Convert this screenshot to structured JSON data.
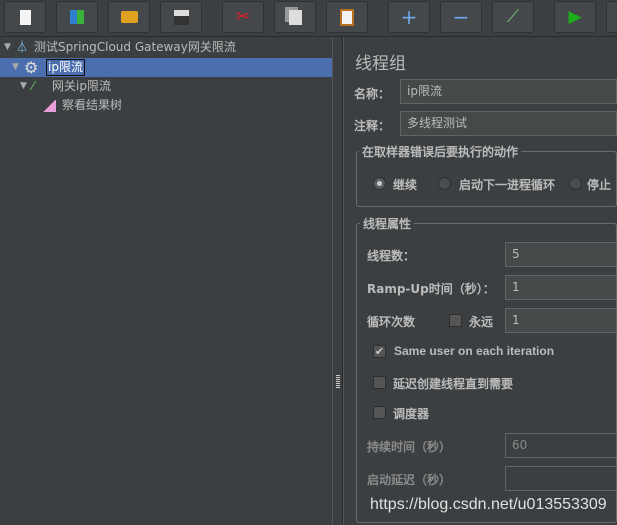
{
  "toolbar": {
    "buttons": [
      {
        "name": "new",
        "icon": "new-file-icon"
      },
      {
        "name": "templates",
        "icon": "templates-icon"
      },
      {
        "name": "open",
        "icon": "open-folder-icon"
      },
      {
        "name": "save",
        "icon": "save-icon"
      },
      {
        "name": "cut",
        "icon": "scissors-icon"
      },
      {
        "name": "copy",
        "icon": "copy-icon"
      },
      {
        "name": "paste",
        "icon": "clipboard-icon"
      },
      {
        "name": "expand",
        "icon": "plus-icon",
        "glyph": "+"
      },
      {
        "name": "collapse",
        "icon": "minus-icon",
        "glyph": "−"
      },
      {
        "name": "toggle",
        "icon": "toggle-icon"
      },
      {
        "name": "start",
        "icon": "play-icon"
      }
    ]
  },
  "tree": {
    "items": [
      {
        "label": "测试SpringCloud Gateway网关限流",
        "icon": "test-plan-flask-icon"
      },
      {
        "label": "ip限流",
        "icon": "thread-group-gear-icon",
        "selected": true
      },
      {
        "label": "网关ip限流",
        "icon": "http-sampler-pipette-icon"
      },
      {
        "label": "察看结果树",
        "icon": "result-tree-icon"
      }
    ]
  },
  "panel": {
    "title": "线程组",
    "name_label": "名称：",
    "name_value": "ip限流",
    "comment_label": "注释：",
    "comment_value": "多线程测试",
    "error_group_title": "在取样器错误后要执行的动作",
    "error_options": [
      "继续",
      "启动下一进程循环",
      "停止"
    ],
    "error_selected": "继续",
    "thread_group_title": "线程属性",
    "threads_label": "线程数：",
    "threads_value": "5",
    "rampup_label": "Ramp-Up时间（秒）：",
    "rampup_value": "1",
    "loop_label": "循环次数",
    "forever_label": "永远",
    "forever_checked": false,
    "loop_value": "1",
    "same_user_label": "Same user on each iteration",
    "same_user_checked": true,
    "delay_label": "延迟创建线程直到需要",
    "delay_checked": false,
    "scheduler_label": "调度器",
    "scheduler_checked": false,
    "duration_label": "持续时间（秒）",
    "duration_value": "60",
    "startup_delay_label": "启动延迟（秒）",
    "startup_delay_value": ""
  },
  "watermark": "https://blog.csdn.net/u013553309"
}
